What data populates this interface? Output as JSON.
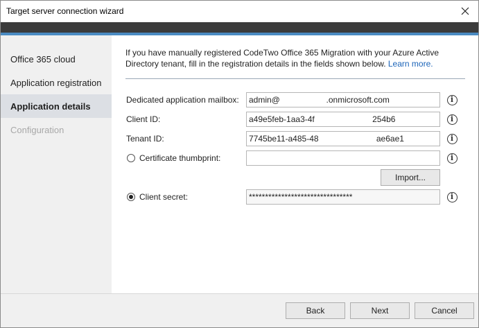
{
  "window": {
    "title": "Target server connection wizard"
  },
  "sidebar": {
    "items": [
      {
        "label": "Office 365 cloud",
        "state": "normal"
      },
      {
        "label": "Application registration",
        "state": "normal"
      },
      {
        "label": "Application details",
        "state": "active"
      },
      {
        "label": "Configuration",
        "state": "disabled"
      }
    ]
  },
  "content": {
    "intro_text": "If you have manually registered CodeTwo Office 365 Migration with your Azure Active Directory tenant, fill in the registration details in the fields shown below. ",
    "learn_more": "Learn more.",
    "fields": {
      "mailbox": {
        "label": "Dedicated application mailbox:",
        "value": "admin@                    .onmicrosoft.com"
      },
      "client_id": {
        "label": "Client ID:",
        "value": "a49e5feb-1aa3-4f                         254b6"
      },
      "tenant_id": {
        "label": "Tenant ID:",
        "value": "7745be11-a485-48                         ae6ae1"
      },
      "cert_thumbprint": {
        "label": "Certificate thumbprint:",
        "value": "",
        "selected": false
      },
      "client_secret": {
        "label": "Client secret:",
        "value": "********************************",
        "selected": true
      }
    },
    "import_button": "Import..."
  },
  "footer": {
    "back": "Back",
    "next": "Next",
    "cancel": "Cancel"
  }
}
